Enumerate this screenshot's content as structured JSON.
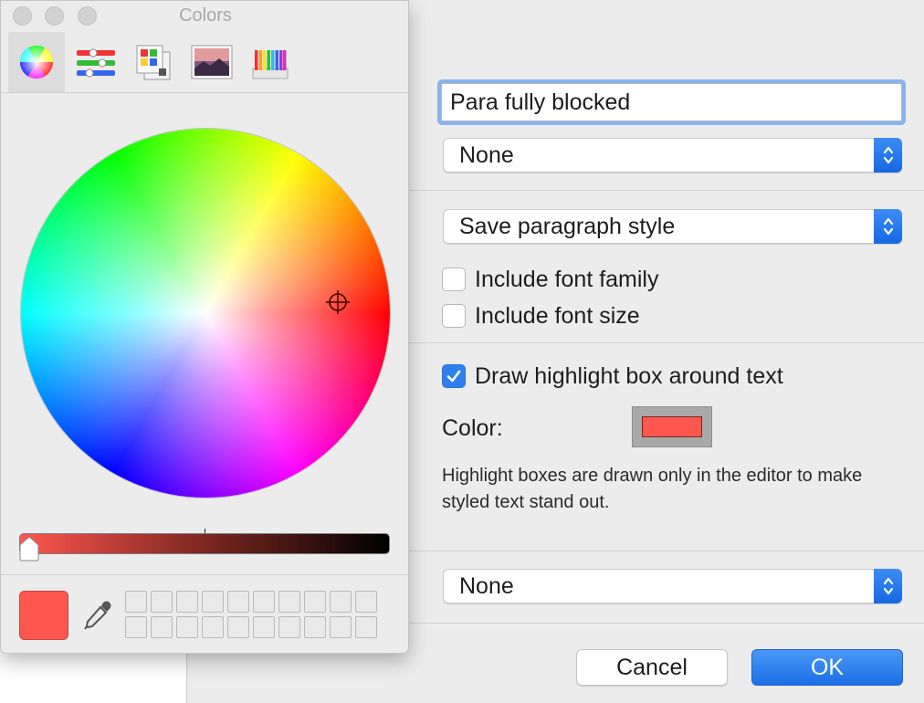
{
  "colors_panel": {
    "title": "Colors",
    "tabs": [
      {
        "name": "color-wheel",
        "active": true
      },
      {
        "name": "color-sliders",
        "active": false
      },
      {
        "name": "color-palettes",
        "active": false
      },
      {
        "name": "image-palettes",
        "active": false
      },
      {
        "name": "pencils",
        "active": false
      }
    ],
    "brightness": 1.0,
    "selected_color": "#ff574d"
  },
  "form": {
    "style_name": "Para fully blocked",
    "first_popup": "None",
    "save_style_popup": "Save paragraph style",
    "include_font_family": {
      "label": "Include font family",
      "checked": false
    },
    "include_font_size": {
      "label": "Include font size",
      "checked": false
    },
    "draw_highlight": {
      "label": "Draw highlight box around text",
      "checked": true
    },
    "color_label": "Color:",
    "highlight_color": "#ff574d",
    "help_text": "Highlight boxes are drawn only in the editor to make styled text stand out.",
    "last_popup": "None"
  },
  "buttons": {
    "cancel": "Cancel",
    "ok": "OK"
  },
  "theme": {
    "accent": "#2f80ef",
    "window_bg": "#ececec"
  }
}
